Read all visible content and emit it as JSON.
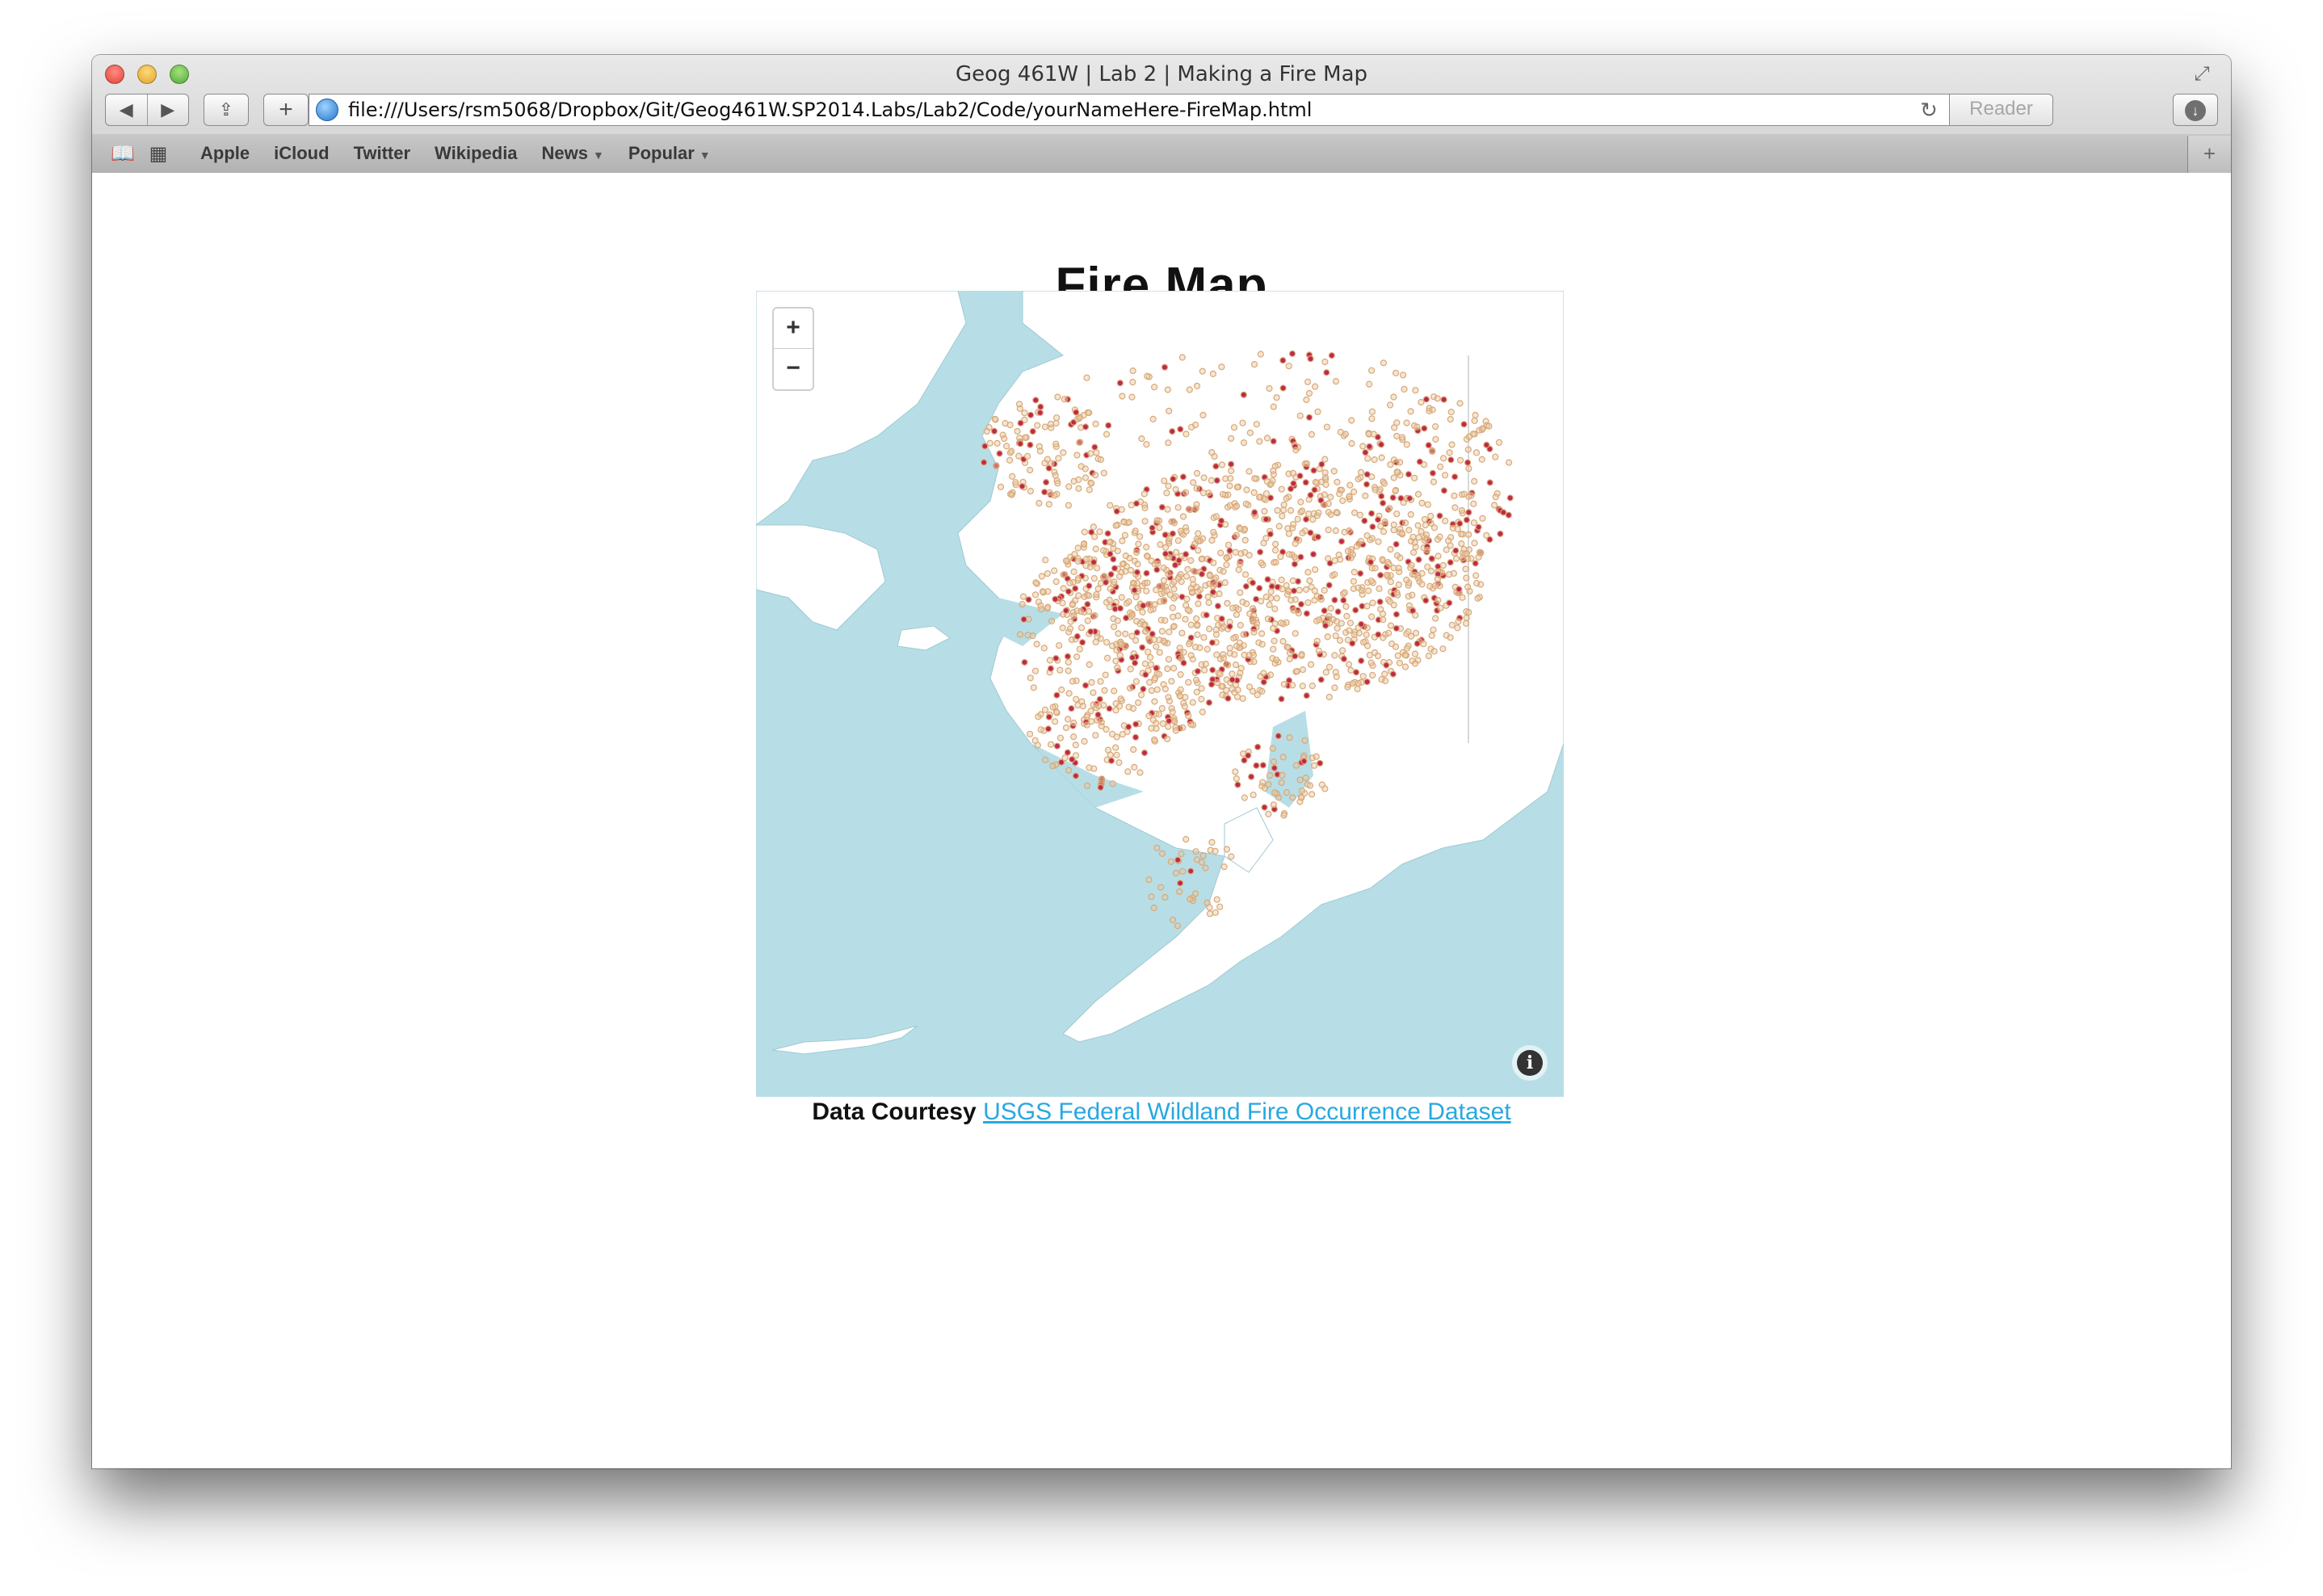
{
  "window": {
    "title": "Geog 461W | Lab 2 | Making a Fire Map"
  },
  "toolbar": {
    "back_icon": "back-arrow",
    "forward_icon": "forward-arrow",
    "share_icon": "share-icon",
    "new_tab_glyph": "+",
    "url": "file:///Users/rsm5068/Dropbox/Git/Geog461W.SP2014.Labs/Lab2/Code/yourNameHere-FireMap.html",
    "reader_label": "Reader"
  },
  "bookmarks": {
    "items": [
      {
        "label": "Apple"
      },
      {
        "label": "iCloud"
      },
      {
        "label": "Twitter"
      },
      {
        "label": "Wikipedia"
      },
      {
        "label": "News"
      },
      {
        "label": "Popular"
      }
    ],
    "add_glyph": "+"
  },
  "page": {
    "title": "Fire Map",
    "credit_label": "Data Courtesy",
    "credit_link": "USGS Federal Wildland Fire Occurrence Dataset"
  },
  "map": {
    "zoom_in": "+",
    "zoom_out": "−",
    "info_glyph": "i",
    "colors": {
      "water": "#b7dee6",
      "land": "#ffffff",
      "fire_outline": "#d9a878",
      "fire_fill": "#c0284a"
    }
  }
}
